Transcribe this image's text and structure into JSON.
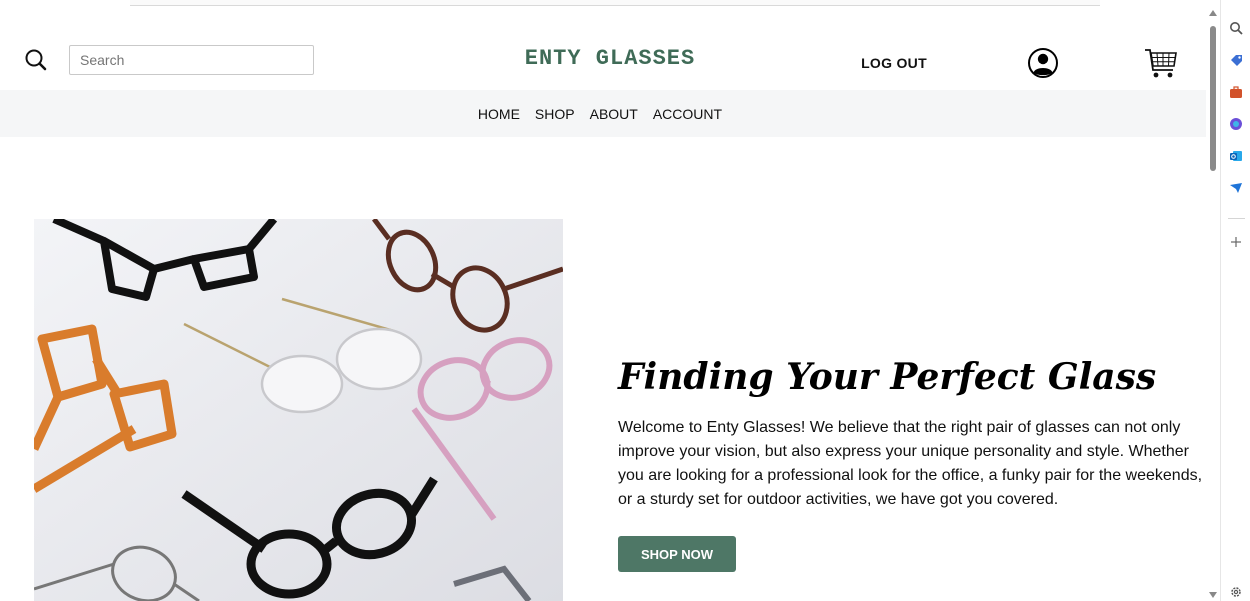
{
  "header": {
    "search_placeholder": "Search",
    "brand": "ENTY GLASSES",
    "logout_label": "LOG OUT"
  },
  "nav": {
    "items": [
      "HOME",
      "SHOP",
      "ABOUT",
      "ACCOUNT"
    ]
  },
  "hero": {
    "title": "Finding Your Perfect Glass",
    "body": "Welcome to Enty Glasses! We believe that the right pair of glasses can not only improve your vision, but also express your unique personality and style. Whether you are looking for a professional look for the office, a funky pair for the weekends, or a sturdy set for outdoor activities, we have got you covered.",
    "cta_label": "SHOP NOW"
  },
  "colors": {
    "brand_text": "#3f6b57",
    "button_bg": "#4e7766",
    "nav_bg": "#f5f6f7",
    "hero_image_bg": "#e9eaee"
  },
  "icons": {
    "header": [
      "search-icon",
      "account-icon",
      "cart-icon"
    ],
    "sidebar": [
      "sidebar-search-icon",
      "tag-icon",
      "briefcase-icon",
      "copilot-icon",
      "outlook-icon",
      "send-icon",
      "add-icon",
      "settings-icon"
    ]
  }
}
